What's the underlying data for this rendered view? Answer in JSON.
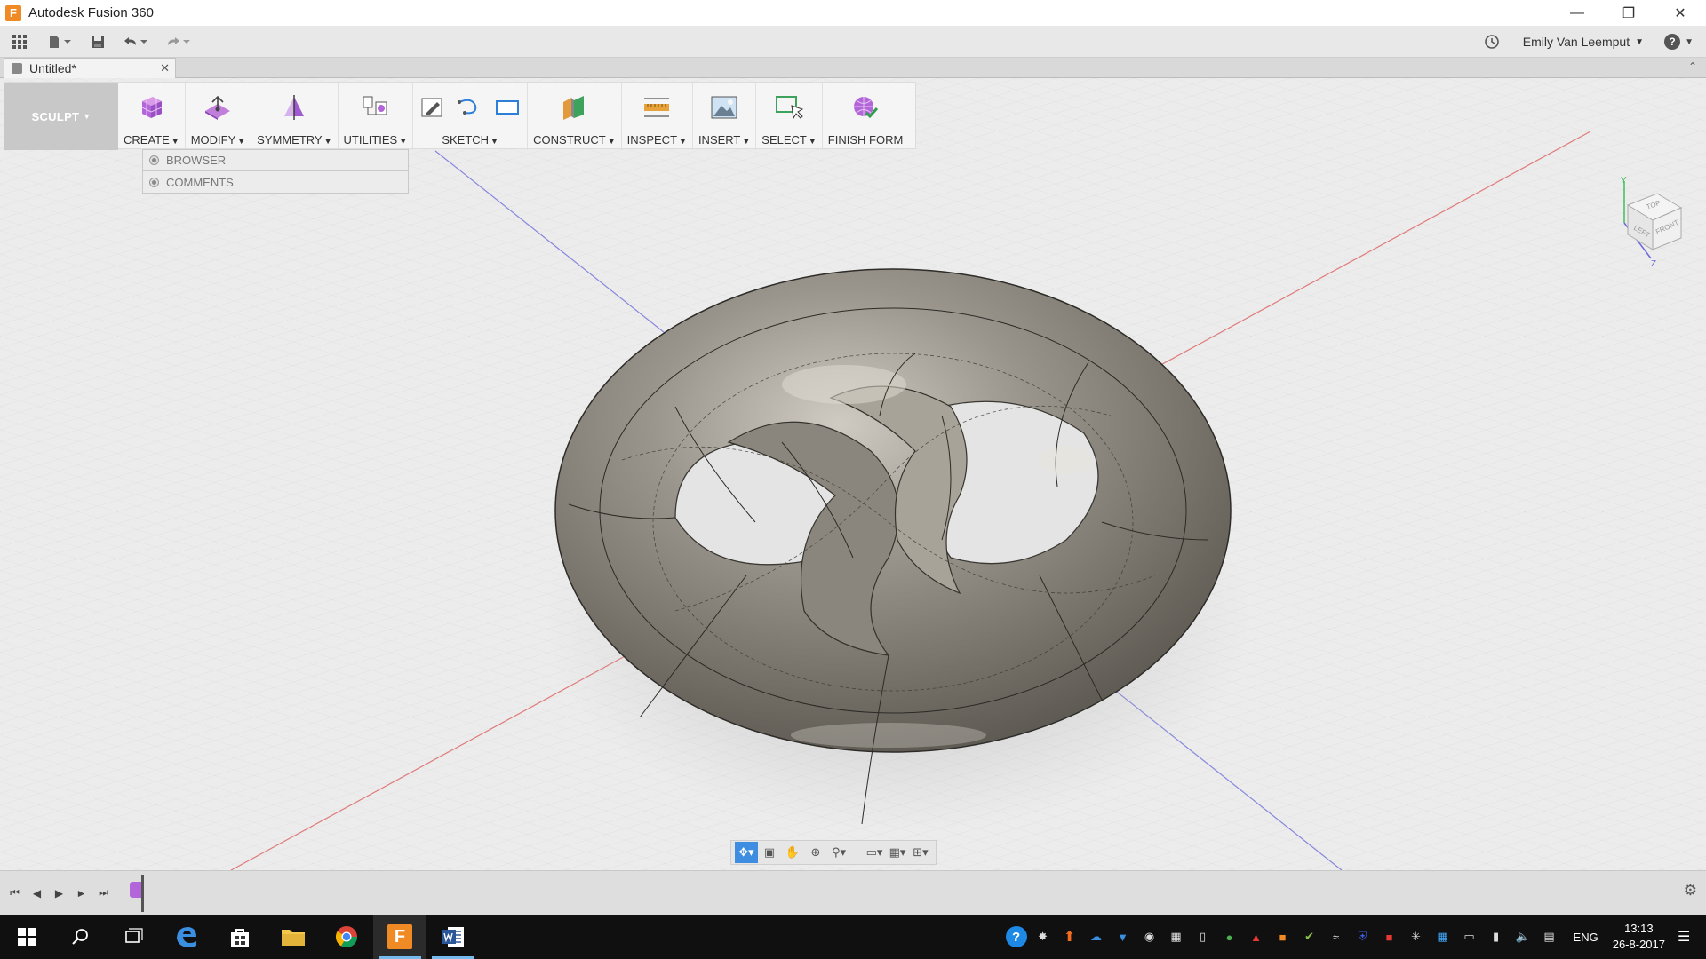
{
  "window": {
    "title": "Autodesk Fusion 360",
    "icon_letter": "F"
  },
  "quick_access": {
    "user_name": "Emily Van Leemput",
    "help_label": "?"
  },
  "document": {
    "tab_title": "Untitled*"
  },
  "toolbar": {
    "workspace": "SCULPT",
    "groups": [
      {
        "label": "CREATE"
      },
      {
        "label": "MODIFY"
      },
      {
        "label": "SYMMETRY"
      },
      {
        "label": "UTILITIES"
      },
      {
        "label": "SKETCH"
      },
      {
        "label": "CONSTRUCT"
      },
      {
        "label": "INSPECT"
      },
      {
        "label": "INSERT"
      },
      {
        "label": "SELECT"
      },
      {
        "label": "FINISH FORM"
      }
    ]
  },
  "browser_panel": {
    "browser_label": "BROWSER",
    "comments_label": "COMMENTS"
  },
  "viewcube": {
    "top": "TOP",
    "left": "LEFT",
    "front": "FRONT",
    "axis_y": "Y",
    "axis_z": "Z"
  },
  "taskbar": {
    "language": "ENG",
    "time": "13:13",
    "date": "26-8-2017"
  },
  "colors": {
    "accent": "#3e8de0",
    "x_axis": "#e06060",
    "z_axis": "#6a6ad8",
    "sculpt_purple": "#b366d9",
    "taskbar": "#101010"
  }
}
